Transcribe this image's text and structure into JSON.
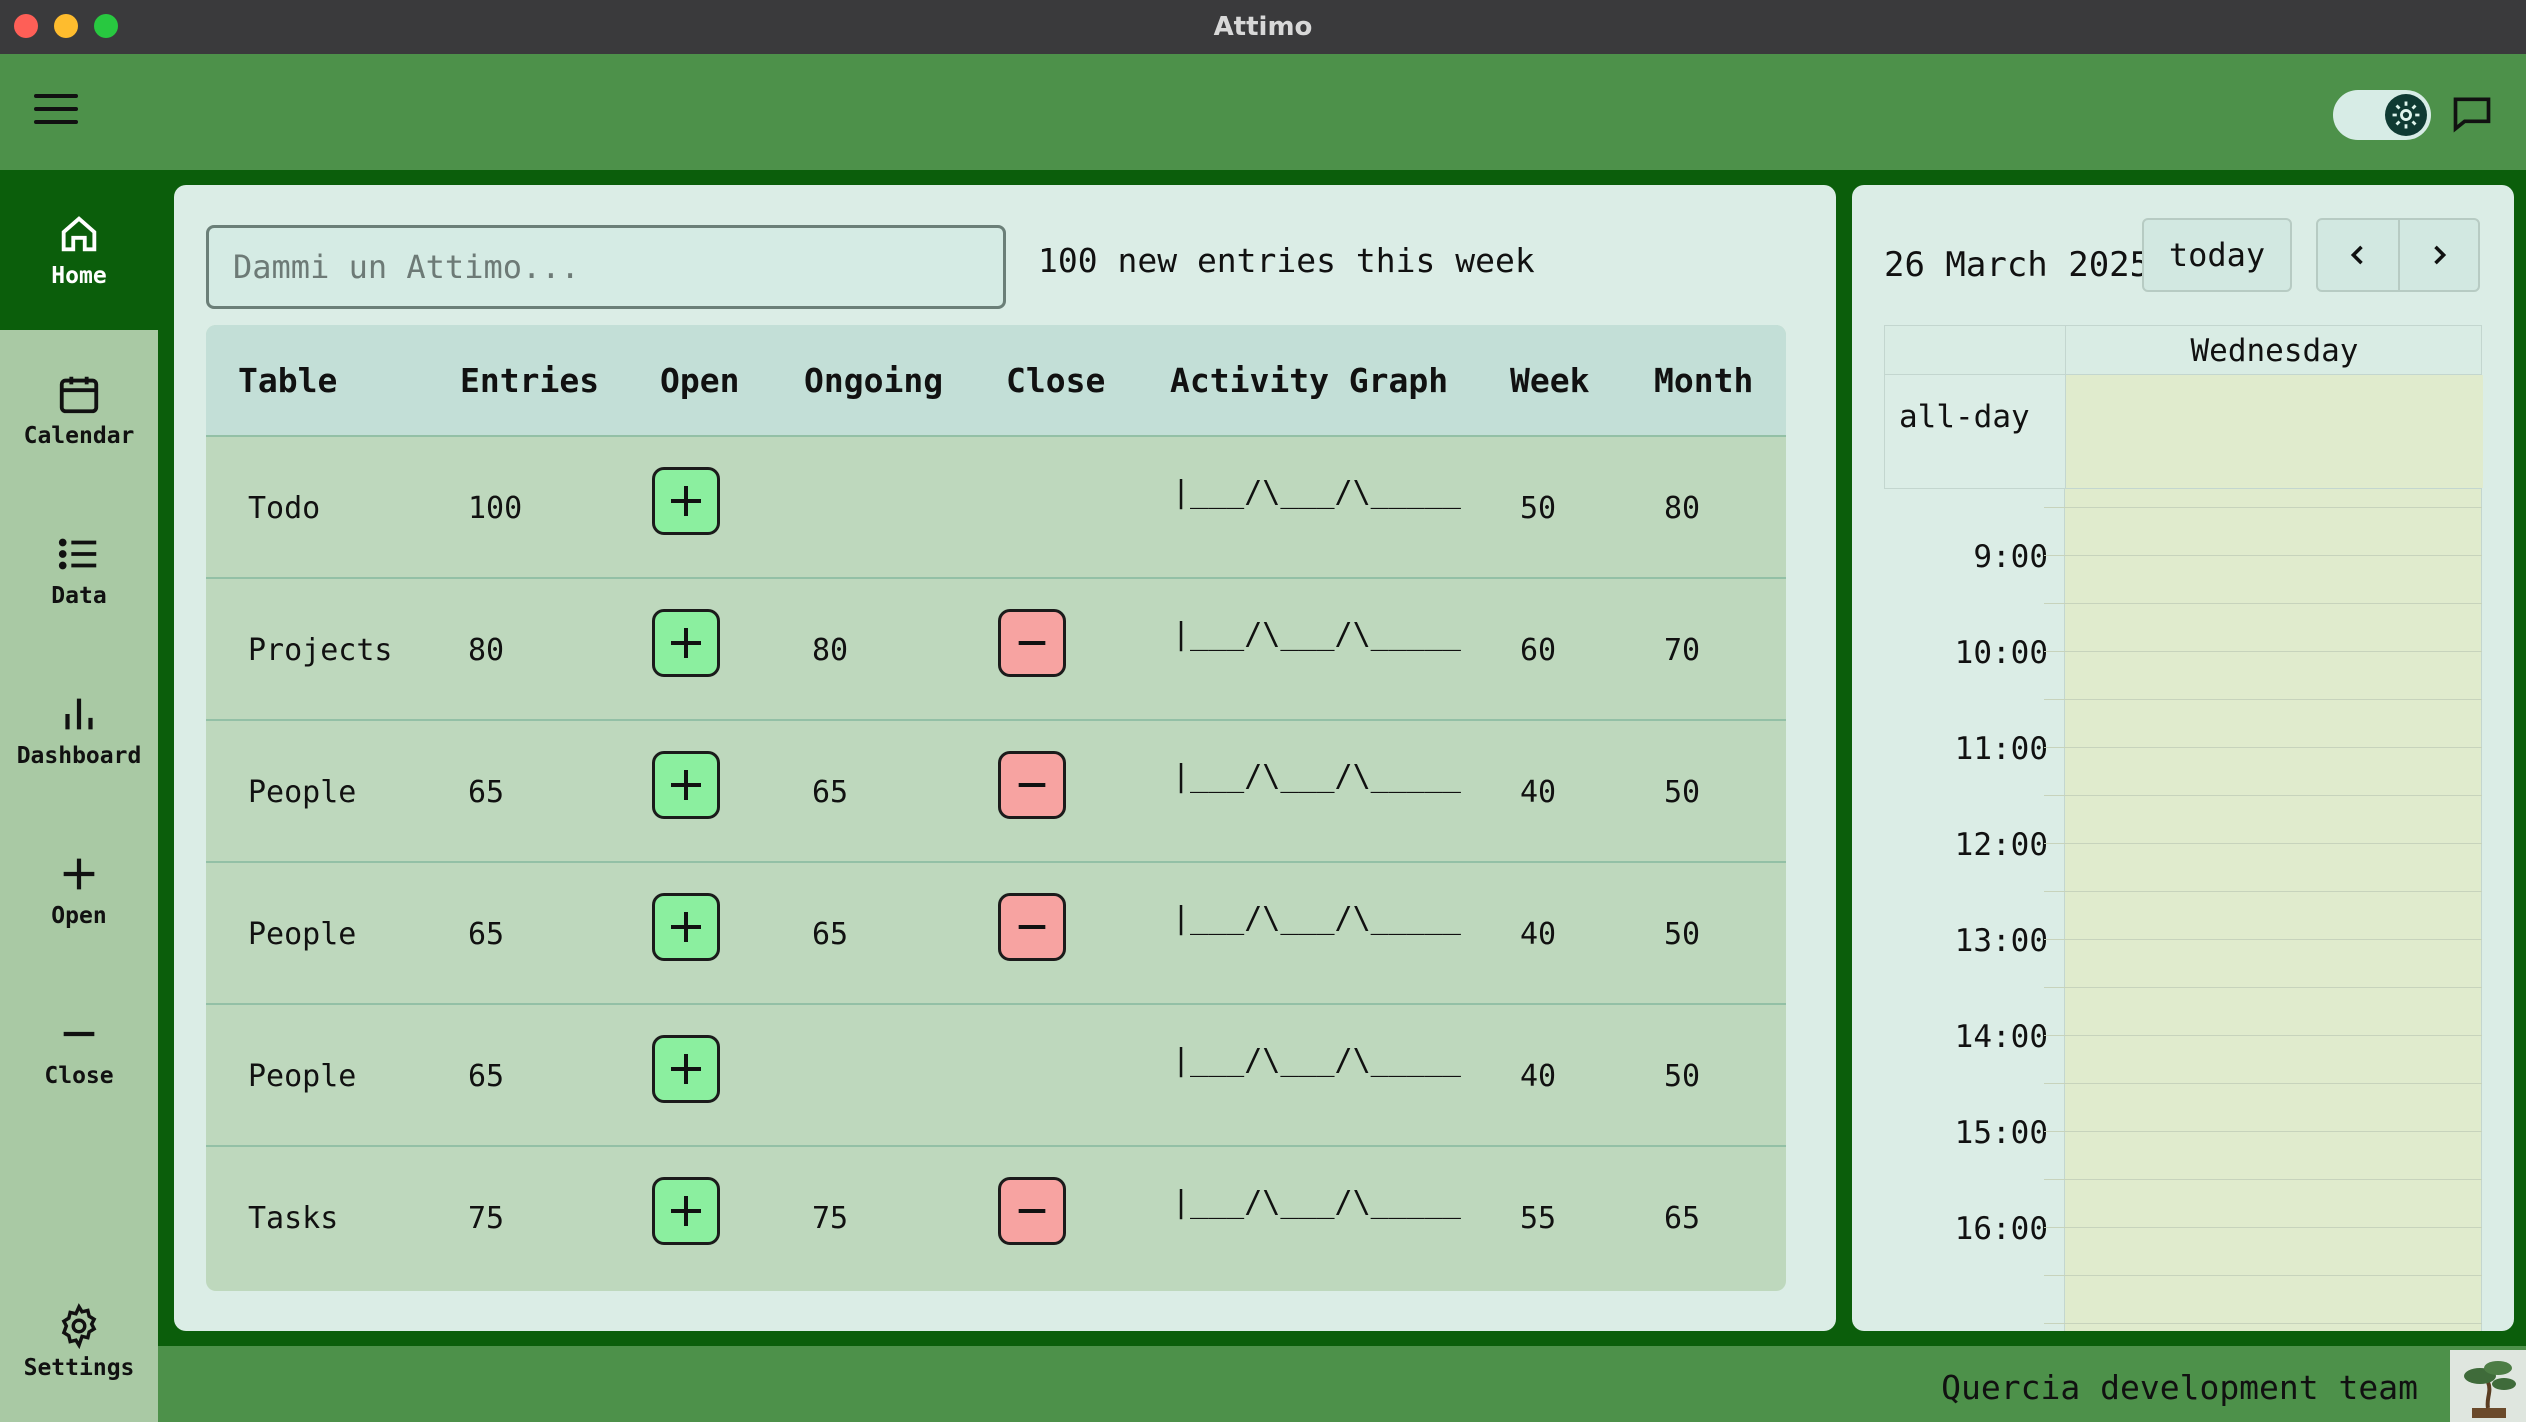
{
  "window": {
    "title": "Attimo"
  },
  "sidebar": {
    "items": [
      {
        "label": "Home",
        "icon": "home-icon",
        "active": true
      },
      {
        "label": "Calendar",
        "icon": "calendar-icon"
      },
      {
        "label": "Data",
        "icon": "list-icon"
      },
      {
        "label": "Dashboard",
        "icon": "bar-chart-icon"
      },
      {
        "label": "Open",
        "icon": "plus-icon"
      },
      {
        "label": "Close",
        "icon": "minus-icon"
      },
      {
        "label": "Settings",
        "icon": "gear-icon"
      }
    ]
  },
  "search": {
    "placeholder": "Dammi un Attimo..."
  },
  "summary": {
    "text": "100 new entries this week"
  },
  "table": {
    "headers": [
      "Table",
      "Entries",
      "Open",
      "Ongoing",
      "Close",
      "Activity Graph",
      "Week",
      "Month"
    ],
    "rows": [
      {
        "table": "Todo",
        "entries": "100",
        "ongoing": "",
        "has_close": false,
        "graph": "|___/\\___/\\_____",
        "week": "50",
        "month": "80"
      },
      {
        "table": "Projects",
        "entries": "80",
        "ongoing": "80",
        "has_close": true,
        "graph": "|___/\\___/\\_____",
        "week": "60",
        "month": "70"
      },
      {
        "table": "People",
        "entries": "65",
        "ongoing": "65",
        "has_close": true,
        "graph": "|___/\\___/\\_____",
        "week": "40",
        "month": "50"
      },
      {
        "table": "People",
        "entries": "65",
        "ongoing": "65",
        "has_close": true,
        "graph": "|___/\\___/\\_____",
        "week": "40",
        "month": "50"
      },
      {
        "table": "People",
        "entries": "65",
        "ongoing": "",
        "has_close": false,
        "graph": "|___/\\___/\\_____",
        "week": "40",
        "month": "50"
      },
      {
        "table": "Tasks",
        "entries": "75",
        "ongoing": "75",
        "has_close": true,
        "graph": "|___/\\___/\\_____",
        "week": "55",
        "month": "65"
      }
    ]
  },
  "calendar": {
    "date": "26 March 2025",
    "today_label": "today",
    "day": "Wednesday",
    "allday_label": "all-day",
    "hours": [
      "9:00",
      "10:00",
      "11:00",
      "12:00",
      "13:00",
      "14:00",
      "15:00",
      "16:00"
    ]
  },
  "footer": {
    "team": "Quercia development team"
  },
  "colors": {
    "frame": "#0b5e0b",
    "bar": "#4d914a",
    "sidebar": "#a9c9a4",
    "card": "#dbede6",
    "open_button": "#8bef9f",
    "close_button": "#f7a3a1"
  }
}
